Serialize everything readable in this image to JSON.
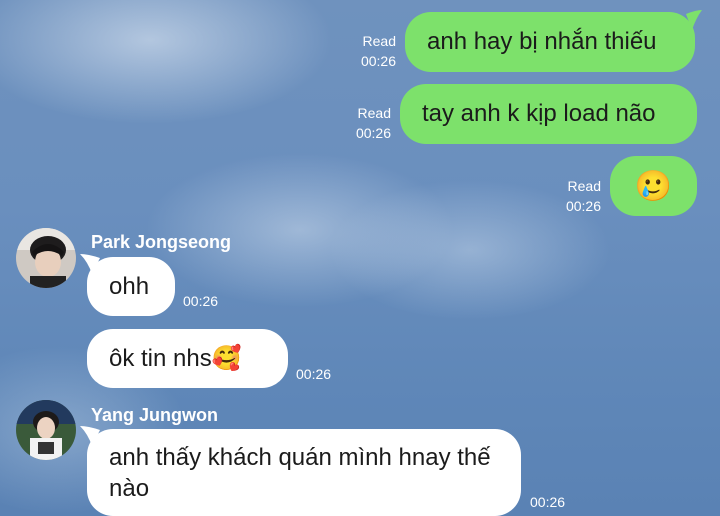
{
  "messages_out": [
    {
      "status": "Read",
      "time": "00:26",
      "text": "anh hay bị nhắn thiếu"
    },
    {
      "status": "Read",
      "time": "00:26",
      "text": "tay anh k kịp load não"
    },
    {
      "status": "Read",
      "time": "00:26",
      "emoji": "🥲"
    }
  ],
  "contacts": [
    {
      "name": "Park Jongseong",
      "messages": [
        {
          "text": "ohh",
          "time": "00:26"
        },
        {
          "text": "ôk tin nhs🥰",
          "time": "00:26"
        }
      ]
    },
    {
      "name": "Yang Jungwon",
      "messages": [
        {
          "text": "anh thấy khách quán mình hnay thế nào",
          "time": "00:26"
        }
      ]
    }
  ],
  "colors": {
    "outgoing": "#7de16b",
    "incoming": "#ffffff",
    "background": "#6a8fbe"
  }
}
